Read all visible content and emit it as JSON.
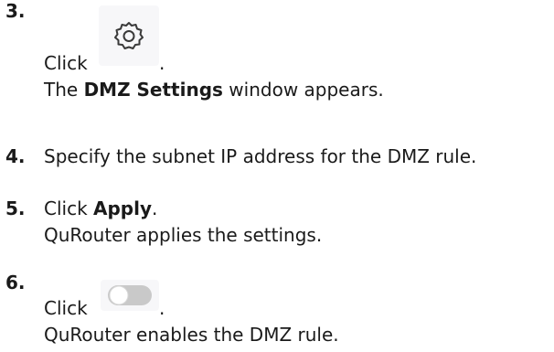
{
  "steps": [
    {
      "number": "3.",
      "click_label": "Click",
      "after_icon": ".",
      "icon": "gear-icon",
      "result_prefix": "The ",
      "result_bold": "DMZ Settings",
      "result_suffix": " window appears."
    },
    {
      "number": "4.",
      "text": "Specify the subnet IP address for the DMZ rule."
    },
    {
      "number": "5.",
      "click_label": "Click ",
      "click_bold": "Apply",
      "click_suffix": ".",
      "result": "QuRouter applies the settings."
    },
    {
      "number": "6.",
      "click_label": "Click",
      "after_icon": ".",
      "icon": "toggle-switch-icon",
      "result": "QuRouter enables the DMZ rule."
    }
  ]
}
